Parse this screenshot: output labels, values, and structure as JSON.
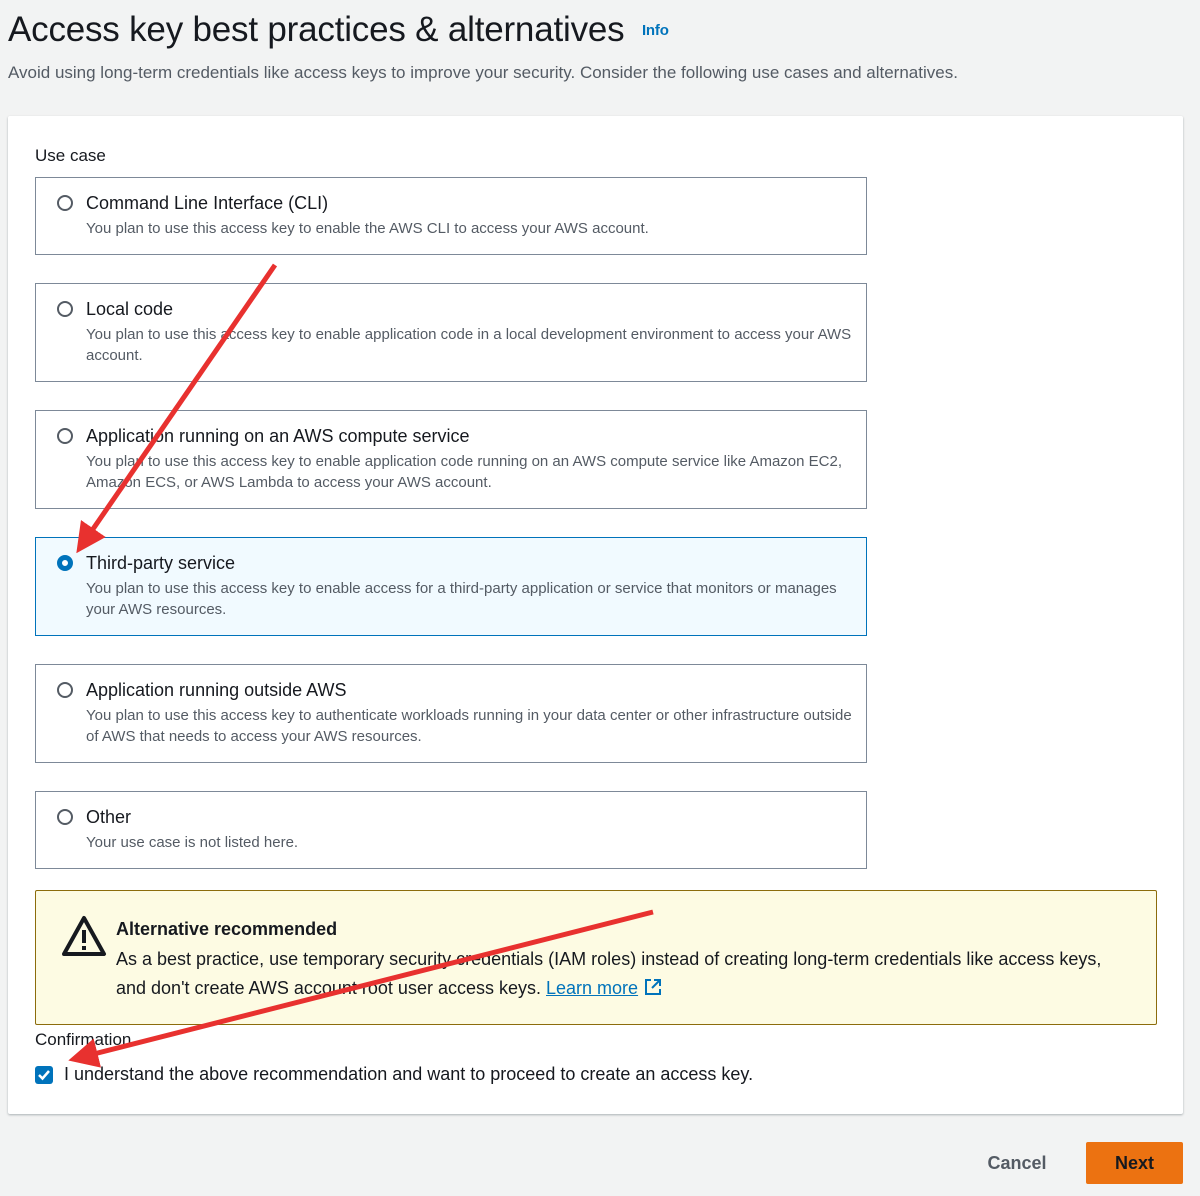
{
  "header": {
    "title": "Access key best practices & alternatives",
    "info_link": "Info",
    "subtitle": "Avoid using long-term credentials like access keys to improve your security. Consider the following use cases and alternatives."
  },
  "use_case": {
    "label": "Use case",
    "selected": "Third-party service",
    "options": [
      {
        "title": "Command Line Interface (CLI)",
        "description": "You plan to use this access key to enable the AWS CLI to access your AWS account."
      },
      {
        "title": "Local code",
        "description": "You plan to use this access key to enable application code in a local development environment to access your AWS account."
      },
      {
        "title": "Application running on an AWS compute service",
        "description": "You plan to use this access key to enable application code running on an AWS compute service like Amazon EC2, Amazon ECS, or AWS Lambda to access your AWS account."
      },
      {
        "title": "Third-party service",
        "description": "You plan to use this access key to enable access for a third-party application or service that monitors or manages your AWS resources."
      },
      {
        "title": "Application running outside AWS",
        "description": "You plan to use this access key to authenticate workloads running in your data center or other infrastructure outside of AWS that needs to access your AWS resources."
      },
      {
        "title": "Other",
        "description": "Your use case is not listed here."
      }
    ]
  },
  "alert": {
    "title": "Alternative recommended",
    "body": "As a best practice, use temporary security credentials (IAM roles) instead of creating long-term credentials like access keys, and don't create AWS account root user access keys.",
    "link": "Learn more",
    "icon": "warning-icon"
  },
  "confirmation": {
    "label": "Confirmation",
    "checkbox_text": "I understand the above recommendation and want to proceed to create an access key.",
    "checked": true
  },
  "footer": {
    "cancel_label": "Cancel",
    "next_label": "Next"
  },
  "colors": {
    "accent": "#0073bb",
    "primary_button": "#ec7211",
    "annotation_arrow": "#e8312f",
    "alert_bg": "#fdfbe3"
  }
}
